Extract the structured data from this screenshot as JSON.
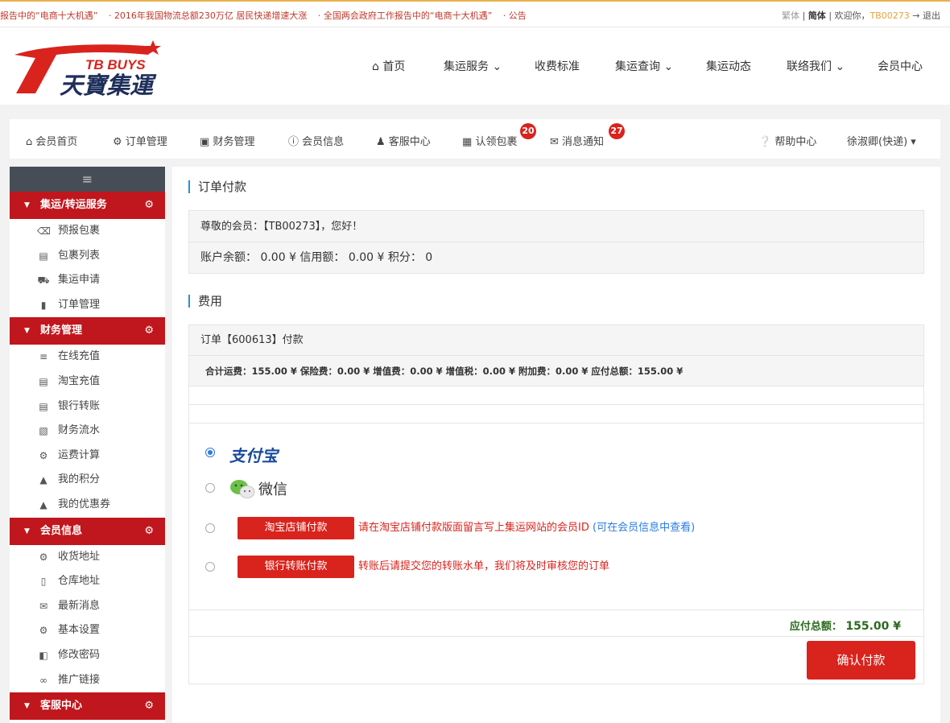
{
  "topbar": {
    "ticker": [
      "报告中的“电商十大机遇”",
      "· 2016年我国物流总额230万亿 居民快递增速大涨",
      "· 全国两会政府工作报告中的“电商十大机遇”",
      "· 公告"
    ],
    "lang_trad": "繁体",
    "lang_simp": "简体",
    "welcome": "欢迎你，",
    "user_id": "TB00273",
    "logout": "退出"
  },
  "logo": {
    "en": "TB BUYS",
    "cn": "天寶集運"
  },
  "main_nav": {
    "home": "首页",
    "service": "集运服务",
    "pricing": "收费标准",
    "query": "集运查询",
    "news": "集运动态",
    "contact": "联络我们",
    "member": "会员中心"
  },
  "member_nav": {
    "home": "会员首页",
    "orders": "订单管理",
    "finance": "财务管理",
    "info": "会员信息",
    "service": "客服中心",
    "claim": "认领包裹",
    "claim_count": "20",
    "messages": "消息通知",
    "messages_count": "27",
    "help": "帮助中心",
    "user": "徐淑卿(快递)"
  },
  "sidebar": {
    "sections": [
      {
        "title": "集运/转运服务",
        "items": [
          "预报包裹",
          "包裹列表",
          "集运申请",
          "订单管理"
        ]
      },
      {
        "title": "财务管理",
        "items": [
          "在线充值",
          "淘宝充值",
          "银行转账",
          "财务流水",
          "运费计算",
          "我的积分",
          "我的优惠券"
        ]
      },
      {
        "title": "会员信息",
        "items": [
          "收货地址",
          "仓库地址",
          "最新消息",
          "基本设置",
          "修改密码",
          "推广链接"
        ]
      },
      {
        "title": "客服中心"
      }
    ]
  },
  "main": {
    "title_payment": "订单付款",
    "greeting": "尊敬的会员：【TB00273】，您好！",
    "balance": "账户余额： 0.00 ¥    信用额： 0.00 ¥    积分： 0",
    "title_fees": "费用",
    "order_line": "订单【600613】付款",
    "fees_line": "合计运费：155.00 ¥    保险费：0.00 ¥    增值费：0.00 ¥    增值税：0.00 ¥    附加费：0.00 ¥    应付总额：155.00 ¥",
    "alipay": "支付宝",
    "wechat": "微信",
    "taobao_btn": "淘宝店铺付款",
    "taobao_hint": "请在淘宝店铺付款版面留言写上集运网站的会员ID",
    "taobao_link": "(可在会员信息中查看)",
    "bank_btn": "银行转账付款",
    "bank_hint": "转账后请提交您的转账水单，我们将及时审核您的订单",
    "total_label": "应付总额：",
    "total_value": "155.00 ¥",
    "confirm": "确认付款"
  },
  "colors": {
    "brand_red": "#d9231d",
    "sidebar_dark": "#474d56",
    "accent_blue": "#2b8ed6"
  }
}
